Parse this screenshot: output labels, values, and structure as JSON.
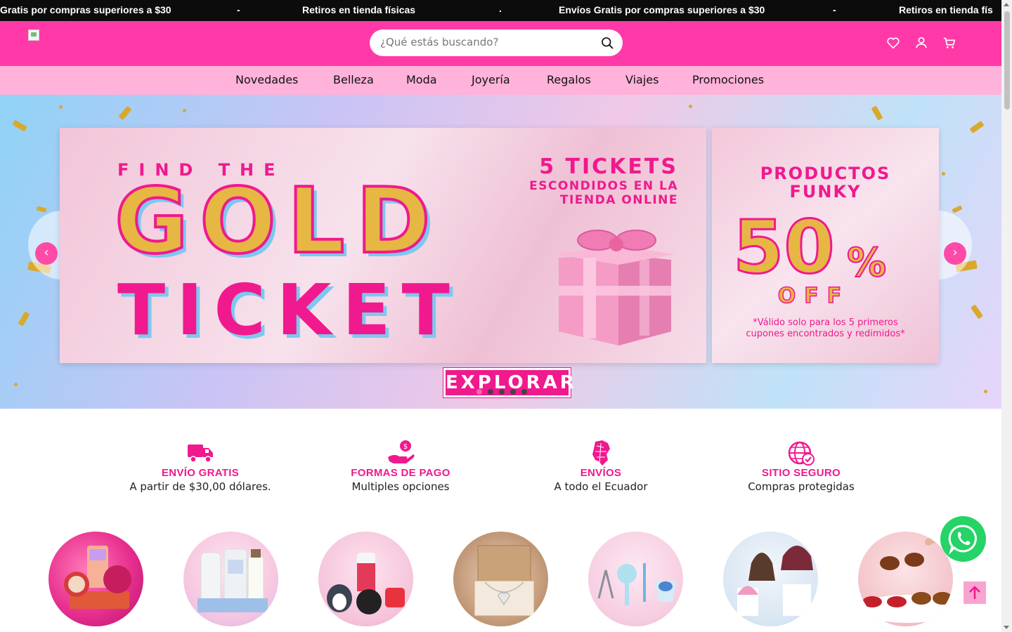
{
  "announcement_bar": {
    "items": [
      "Gratis por compras superiores a $30",
      "-",
      "Retiros en tienda físicas",
      ".",
      "Envíos Gratis por compras superiores a $30",
      "-",
      "Retiros en tienda fís"
    ]
  },
  "header": {
    "search_placeholder": "¿Qué estás buscando?",
    "icons": [
      "search-icon",
      "heart-icon",
      "user-icon",
      "cart-icon"
    ]
  },
  "nav": {
    "items": [
      "Novedades",
      "Belleza",
      "Moda",
      "Joyería",
      "Regalos",
      "Viajes",
      "Promociones"
    ]
  },
  "hero": {
    "left_banner": {
      "kicker": "FIND THE",
      "headline_1": "GOLD",
      "headline_2": "TICKET",
      "tickets_count": "5 TICKETS",
      "tickets_line_1": "ESCONDIDOS EN LA",
      "tickets_line_2": "TIENDA ONLINE"
    },
    "right_banner": {
      "line_1": "PRODUCTOS",
      "line_2": "FUNKY",
      "discount_number": "50",
      "discount_symbol": "%",
      "discount_word": "OFF",
      "note_line_1": "*Válido solo para los 5 primeros",
      "note_line_2": "cupones encontrados y redimidos*"
    },
    "cta_label": "EXPLORAR",
    "slide_count": 5,
    "active_slide": 1,
    "prev_glyph": "‹",
    "next_glyph": "›"
  },
  "features": [
    {
      "icon": "truck-icon",
      "title": "ENVÍO GRATIS",
      "subtitle": "A partir de $30,00 dólares."
    },
    {
      "icon": "payment-hand-icon",
      "title": "FORMAS DE PAGO",
      "subtitle": "Multiples opciones"
    },
    {
      "icon": "ecuador-map-icon",
      "title": "ENVÍOS",
      "subtitle": "A todo el Ecuador"
    },
    {
      "icon": "secure-globe-icon",
      "title": "SITIO SEGURO",
      "subtitle": "Compras protegidas"
    }
  ],
  "categories": [
    {
      "name": "category-makeup"
    },
    {
      "name": "category-skincare"
    },
    {
      "name": "category-gifts"
    },
    {
      "name": "category-jewelry"
    },
    {
      "name": "category-beauty-tools"
    },
    {
      "name": "category-bags"
    },
    {
      "name": "category-sunglasses"
    }
  ],
  "colors": {
    "brand_pink": "#ff3aa8",
    "nav_pink": "#ffb2da",
    "accent_magenta": "#f0198e",
    "gold": "#e6b743",
    "whatsapp_green": "#25d366"
  }
}
